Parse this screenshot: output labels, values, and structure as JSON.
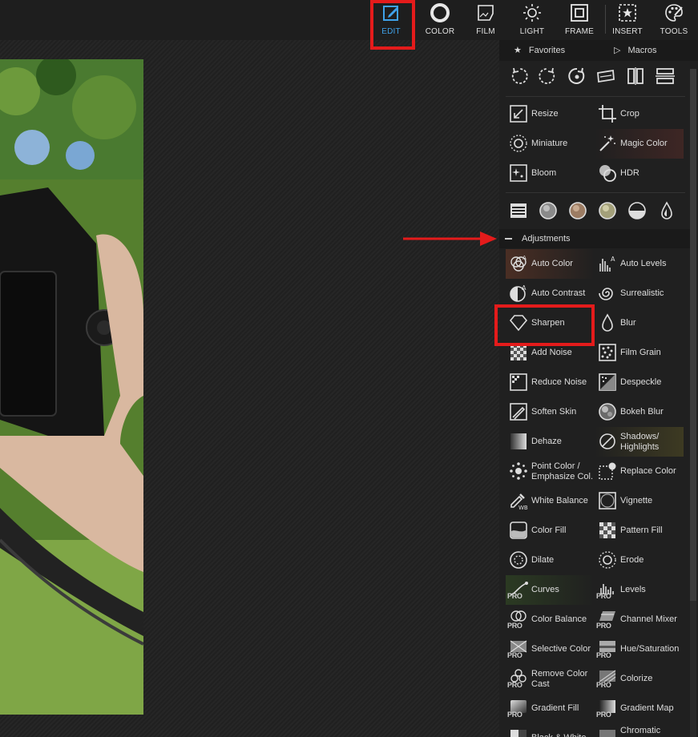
{
  "toolbar": {
    "buttons": [
      {
        "label": "EDIT",
        "icon": "edit-icon",
        "active": true
      },
      {
        "label": "COLOR",
        "icon": "color-icon"
      },
      {
        "label": "FILM",
        "icon": "film-icon"
      },
      {
        "label": "LIGHT",
        "icon": "light-icon"
      },
      {
        "label": "FRAME",
        "icon": "frame-icon"
      },
      {
        "label": "INSERT",
        "icon": "insert-icon"
      },
      {
        "label": "TOOLS",
        "icon": "tools-icon"
      }
    ],
    "active_color": "#3fa2ea"
  },
  "panel": {
    "tabs": {
      "favorites": "Favorites",
      "macros": "Macros"
    },
    "rotate_tools": [
      "rotate-left-icon",
      "rotate-right-icon",
      "rotate-free-icon",
      "straighten-icon",
      "flip-horizontal-icon",
      "flip-vertical-icon"
    ],
    "basic": [
      {
        "label": "Resize",
        "icon": "resize-icon"
      },
      {
        "label": "Crop",
        "icon": "crop-icon"
      },
      {
        "label": "Miniature",
        "icon": "miniature-icon"
      },
      {
        "label": "Magic Color",
        "icon": "magic-color-icon"
      },
      {
        "label": "Bloom",
        "icon": "bloom-icon"
      },
      {
        "label": "HDR",
        "icon": "hdr-icon"
      }
    ],
    "filter_presets": [
      "list-icon",
      "sphere-gray-icon",
      "sphere-tan-icon",
      "sphere-olive-icon",
      "half-circle-icon",
      "drop-icon"
    ],
    "adjustments": {
      "title": "Adjustments",
      "items": [
        {
          "label": "Auto Color",
          "icon": "auto-color-icon"
        },
        {
          "label": "Auto Levels",
          "icon": "auto-levels-icon"
        },
        {
          "label": "Auto Contrast",
          "icon": "auto-contrast-icon"
        },
        {
          "label": "Surrealistic",
          "icon": "surrealistic-icon"
        },
        {
          "label": "Sharpen",
          "icon": "sharpen-icon"
        },
        {
          "label": "Blur",
          "icon": "blur-icon"
        },
        {
          "label": "Add Noise",
          "icon": "add-noise-icon"
        },
        {
          "label": "Film Grain",
          "icon": "film-grain-icon"
        },
        {
          "label": "Reduce Noise",
          "icon": "reduce-noise-icon"
        },
        {
          "label": "Despeckle",
          "icon": "despeckle-icon"
        },
        {
          "label": "Soften Skin",
          "icon": "soften-skin-icon"
        },
        {
          "label": "Bokeh Blur",
          "icon": "bokeh-blur-icon"
        },
        {
          "label": "Dehaze",
          "icon": "dehaze-icon"
        },
        {
          "label": "Shadows/ Highlights",
          "icon": "shadows-highlights-icon"
        },
        {
          "label": "Point Color / Emphasize Col.",
          "icon": "point-color-icon"
        },
        {
          "label": "Replace Color",
          "icon": "replace-color-icon"
        },
        {
          "label": "White Balance",
          "icon": "white-balance-icon"
        },
        {
          "label": "Vignette",
          "icon": "vignette-icon"
        },
        {
          "label": "Color Fill",
          "icon": "color-fill-icon"
        },
        {
          "label": "Pattern Fill",
          "icon": "pattern-fill-icon"
        },
        {
          "label": "Dilate",
          "icon": "dilate-icon"
        },
        {
          "label": "Erode",
          "icon": "erode-icon"
        },
        {
          "label": "Curves",
          "icon": "curves-icon",
          "pro": true
        },
        {
          "label": "Levels",
          "icon": "levels-icon",
          "pro": true
        },
        {
          "label": "Color Balance",
          "icon": "color-balance-icon",
          "pro": true
        },
        {
          "label": "Channel Mixer",
          "icon": "channel-mixer-icon",
          "pro": true
        },
        {
          "label": "Selective Color",
          "icon": "selective-color-icon",
          "pro": true
        },
        {
          "label": "Hue/Saturation",
          "icon": "hue-saturation-icon",
          "pro": true
        },
        {
          "label": "Remove Color Cast",
          "icon": "remove-color-cast-icon",
          "pro": true
        },
        {
          "label": "Colorize",
          "icon": "colorize-icon",
          "pro": true
        },
        {
          "label": "Gradient Fill",
          "icon": "gradient-fill-icon",
          "pro": true
        },
        {
          "label": "Gradient Map",
          "icon": "gradient-map-icon",
          "pro": true
        },
        {
          "label": "Black & White",
          "icon": "black-white-icon",
          "pro": true
        },
        {
          "label": "Chromatic",
          "icon": "chromatic-icon",
          "pro": true
        }
      ]
    },
    "pro_label": "PRO"
  },
  "annotations": {
    "highlight_color": "#e41b1b"
  }
}
